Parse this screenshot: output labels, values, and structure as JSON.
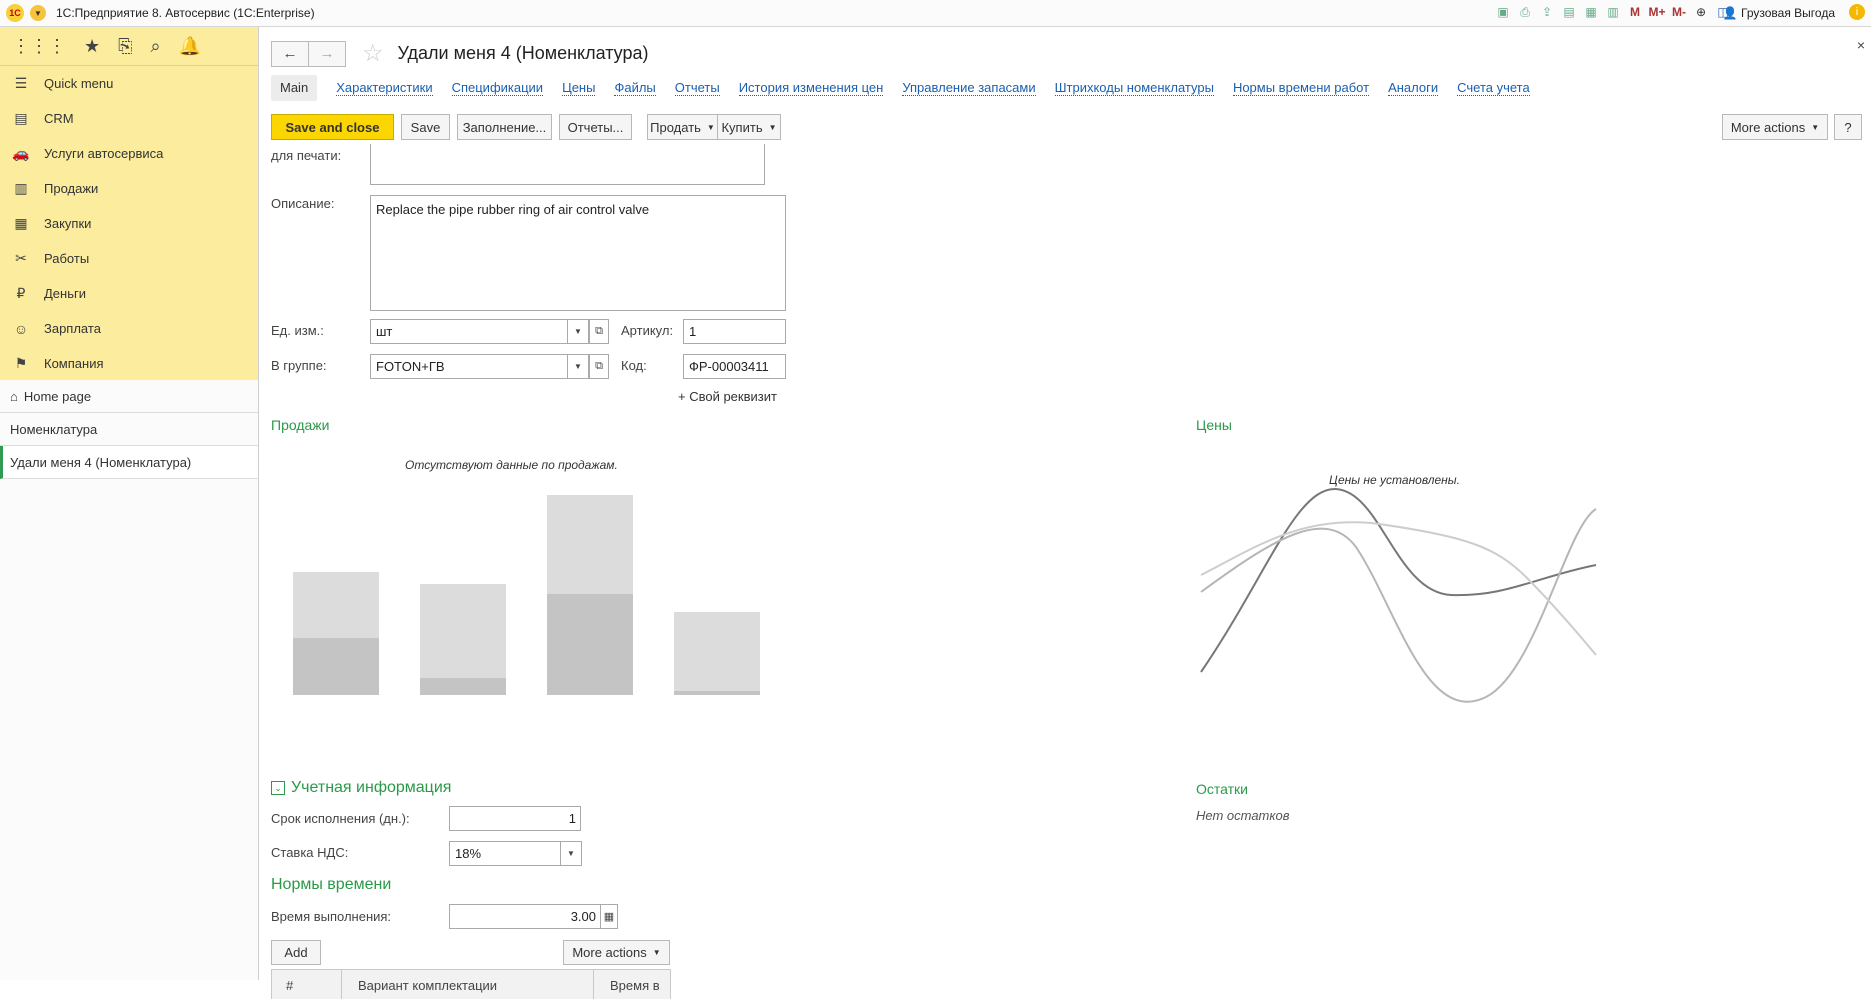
{
  "titlebar": {
    "logo": "1С",
    "title": "1С:Предприятие 8. Автосервис  (1С:Enterprise)",
    "user": "Грузовая Выгода",
    "icons": [
      "save-icon",
      "print-icon",
      "upload-icon",
      "printer-icon",
      "calculator-icon",
      "calendar-icon",
      "M",
      "M+",
      "M-",
      "zoom-icon",
      "panel-icon"
    ]
  },
  "sidebar": {
    "items": [
      {
        "label": "Quick menu",
        "icon": "list-icon",
        "glyph": "☰"
      },
      {
        "label": "CRM",
        "icon": "crm-icon",
        "glyph": "▤"
      },
      {
        "label": "Услуги автосервиса",
        "icon": "car-icon",
        "glyph": "🚗"
      },
      {
        "label": "Продажи",
        "icon": "basket-icon",
        "glyph": "▥"
      },
      {
        "label": "Закупки",
        "icon": "cart-icon",
        "glyph": "▦"
      },
      {
        "label": "Работы",
        "icon": "tools-icon",
        "glyph": "✂"
      },
      {
        "label": "Деньги",
        "icon": "money-icon",
        "glyph": "₽"
      },
      {
        "label": "Зарплата",
        "icon": "people-icon",
        "glyph": "☺"
      },
      {
        "label": "Компания",
        "icon": "flag-icon",
        "glyph": "⚑"
      }
    ],
    "open": [
      {
        "label": "Home page"
      },
      {
        "label": "Номенклатура"
      },
      {
        "label": "Удали меня 4 (Номенклатура)"
      }
    ]
  },
  "form": {
    "title": "Удали меня 4 (Номенклатура)",
    "tabs": [
      "Main",
      "Характеристики",
      "Спецификации",
      "Цены",
      "Файлы",
      "Отчеты",
      "История изменения цен",
      "Управление запасами",
      "Штрихкоды номенклатуры",
      "Нормы времени работ",
      "Аналоги",
      "Счета учета"
    ],
    "buttons": {
      "save_close": "Save and close",
      "save": "Save",
      "fill": "Заполнение...",
      "reports": "Отчеты...",
      "sell": "Продать",
      "buy": "Купить",
      "more_actions": "More actions",
      "help": "?"
    },
    "print_label": "для печати:",
    "description_label": "Описание:",
    "description_value": "Replace the pipe rubber ring of air control valve",
    "unit_label": "Ед. изм.:",
    "unit_value": "шт",
    "article_label": "Артикул:",
    "article_value": "1",
    "group_label": "В группе:",
    "group_value": "FOTON+ГВ",
    "code_label": "Код:",
    "code_value": "ФР-00003411",
    "custom_attr": "+ Свой реквизит"
  },
  "sales": {
    "title": "Продажи",
    "empty": "Отсутствуют данные по продажам."
  },
  "prices": {
    "title": "Цены",
    "empty": "Цены не установлены."
  },
  "accounting": {
    "title": "Учетная информация",
    "term_label": "Срок исполнения (дн.):",
    "term_value": "1",
    "vat_label": "Ставка НДС:",
    "vat_value": "18%"
  },
  "stock": {
    "title": "Остатки",
    "empty": "Нет остатков"
  },
  "norms": {
    "title": "Нормы времени",
    "time_label": "Время выполнения:",
    "time_value": "3.00",
    "add": "Add",
    "more_actions": "More actions",
    "columns": [
      "#",
      "Вариант комплектации",
      "Время в"
    ]
  }
}
